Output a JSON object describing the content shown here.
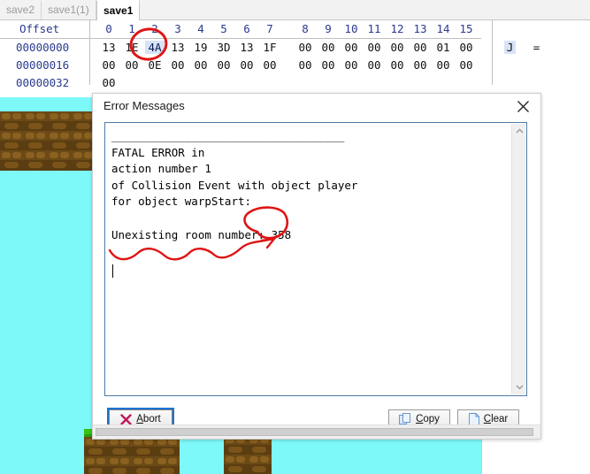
{
  "hex_editor": {
    "tabs": [
      {
        "label": "save2",
        "active": false
      },
      {
        "label": "save1(1)",
        "active": false
      },
      {
        "label": "save1",
        "active": true
      }
    ],
    "offset_header": "Offset",
    "column_headers": [
      "0",
      "1",
      "2",
      "3",
      "4",
      "5",
      "6",
      "7",
      "8",
      "9",
      "10",
      "11",
      "12",
      "13",
      "14",
      "15"
    ],
    "rows": [
      {
        "offset": "00000000",
        "bytes": [
          "13",
          "1E",
          "4A",
          "13",
          "19",
          "3D",
          "13",
          "1F",
          "00",
          "00",
          "00",
          "00",
          "00",
          "00",
          "01",
          "00"
        ],
        "selected_index": 2,
        "ascii": [
          "J",
          "",
          "",
          "",
          "",
          "",
          "",
          "",
          "",
          "",
          "",
          "",
          "",
          "=",
          "",
          ""
        ]
      },
      {
        "offset": "00000016",
        "bytes": [
          "00",
          "00",
          "0E",
          "00",
          "00",
          "00",
          "00",
          "00",
          "00",
          "00",
          "00",
          "00",
          "00",
          "00",
          "00",
          "00"
        ],
        "selected_index": -1,
        "ascii": [
          "",
          "",
          "",
          "",
          "",
          "",
          "",
          "",
          "",
          "",
          "",
          "",
          "",
          "",
          "",
          ""
        ]
      },
      {
        "offset": "00000032",
        "bytes": [
          "00"
        ],
        "selected_index": -1,
        "ascii": [
          ""
        ]
      }
    ],
    "ascii_visible": [
      "J",
      "="
    ]
  },
  "dialog": {
    "title": "Error Messages",
    "close_icon": "close-x-icon",
    "message": "___________________________________\nFATAL ERROR in\naction number 1\nof Collision Event with object player\nfor object warpStart:\n\nUnexisting room number: 358",
    "buttons": {
      "abort": {
        "label": "Abort",
        "icon": "red-x-icon",
        "accel": "A",
        "focused": true
      },
      "copy": {
        "label": "Copy",
        "icon": "copy-pages-icon",
        "accel": "C"
      },
      "clear": {
        "label": "Clear",
        "icon": "blank-page-icon",
        "accel": "C"
      }
    },
    "scrollbar": {
      "up_icon": "chevron-up-icon",
      "down_icon": "chevron-down-icon"
    }
  },
  "annotations": {
    "circle_hex_byte": "4A",
    "circle_room_number": "358",
    "ink_color": "#e01414"
  },
  "game": {
    "sky_color": "#7DF9F9",
    "brick_color": "#6b4a16",
    "grass_color": "#38c218"
  },
  "colors": {
    "hex_text_blue": "#2b3a8f",
    "selection_blue": "#d7e3f7",
    "focus_ring": "#1b74d4"
  }
}
